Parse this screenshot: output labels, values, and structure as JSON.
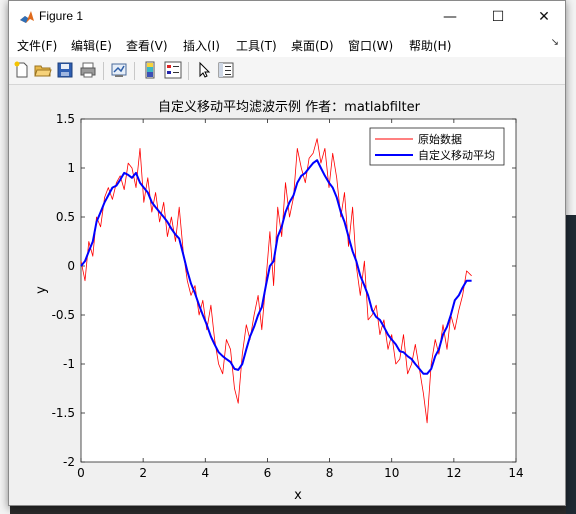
{
  "window": {
    "title": "Figure 1",
    "minimize_glyph": "—",
    "maximize_glyph": "☐",
    "close_glyph": "✕"
  },
  "menu": [
    {
      "label": "文件(F)"
    },
    {
      "label": "编辑(E)"
    },
    {
      "label": "查看(V)"
    },
    {
      "label": "插入(I)"
    },
    {
      "label": "工具(T)"
    },
    {
      "label": "桌面(D)"
    },
    {
      "label": "窗口(W)"
    },
    {
      "label": "帮助(H)"
    }
  ],
  "menu_overflow_glyph": "↘",
  "toolbar": {
    "icons": [
      "new-figure-icon",
      "open-folder-icon",
      "save-icon",
      "print-icon",
      "link-plot-icon",
      "insert-colorbar-icon",
      "insert-legend-icon",
      "pointer-icon",
      "property-editor-icon"
    ]
  },
  "colors": {
    "original": "#ff0000",
    "filtered": "#0000ff",
    "axes_bg": "#ffffff",
    "figure_bg": "#f0f0f0"
  },
  "chart_data": {
    "type": "line",
    "title": "自定义移动平均滤波示例 作者：matlabfilter",
    "xlabel": "x",
    "ylabel": "y",
    "xlim": [
      0,
      14
    ],
    "ylim": [
      -2,
      1.5
    ],
    "xticks": [
      "0",
      "2",
      "4",
      "6",
      "8",
      "10",
      "12",
      "14"
    ],
    "yticks": [
      "1.5",
      "1",
      "0.5",
      "0",
      "-0.5",
      "-1",
      "-1.5",
      "-2"
    ],
    "grid": false,
    "legend_position": "top-right",
    "series": [
      {
        "name": "原始数据",
        "color": "#ff0000",
        "linewidth": 0.8,
        "x": [
          0.0,
          0.13,
          0.25,
          0.38,
          0.5,
          0.63,
          0.76,
          0.88,
          1.01,
          1.14,
          1.26,
          1.39,
          1.52,
          1.64,
          1.77,
          1.9,
          2.02,
          2.15,
          2.28,
          2.4,
          2.53,
          2.66,
          2.78,
          2.91,
          3.04,
          3.16,
          3.29,
          3.42,
          3.54,
          3.67,
          3.8,
          3.92,
          4.05,
          4.18,
          4.3,
          4.43,
          4.56,
          4.68,
          4.81,
          4.94,
          5.06,
          5.19,
          5.32,
          5.44,
          5.57,
          5.7,
          5.82,
          5.95,
          6.08,
          6.2,
          6.33,
          6.46,
          6.58,
          6.71,
          6.84,
          6.96,
          7.09,
          7.22,
          7.34,
          7.47,
          7.6,
          7.72,
          7.85,
          7.98,
          8.1,
          8.23,
          8.36,
          8.48,
          8.61,
          8.74,
          8.86,
          8.99,
          9.12,
          9.24,
          9.37,
          9.5,
          9.62,
          9.75,
          9.88,
          10.0,
          10.13,
          10.26,
          10.38,
          10.51,
          10.64,
          10.76,
          10.89,
          11.02,
          11.14,
          11.27,
          11.4,
          11.52,
          11.65,
          11.78,
          11.9,
          12.03,
          12.16,
          12.28,
          12.41,
          12.57
        ],
        "y": [
          0.05,
          -0.15,
          0.25,
          0.1,
          0.5,
          0.4,
          0.7,
          0.8,
          0.68,
          0.85,
          0.92,
          0.78,
          1.05,
          1.0,
          0.8,
          1.2,
          0.65,
          0.9,
          0.55,
          0.75,
          0.45,
          0.65,
          0.3,
          0.5,
          0.25,
          0.6,
          0.15,
          -0.15,
          -0.3,
          -0.2,
          -0.5,
          -0.35,
          -0.65,
          -0.4,
          -0.75,
          -1.0,
          -1.1,
          -0.75,
          -0.85,
          -1.25,
          -1.4,
          -0.9,
          -0.6,
          -0.75,
          -0.5,
          -0.3,
          -0.65,
          -0.15,
          0.35,
          -0.2,
          0.6,
          0.3,
          0.85,
          0.5,
          0.7,
          1.2,
          1.0,
          0.85,
          1.1,
          1.15,
          1.3,
          1.05,
          1.2,
          0.8,
          1.15,
          0.9,
          0.5,
          0.75,
          0.2,
          0.6,
          0.0,
          -0.3,
          0.05,
          -0.55,
          -0.5,
          -0.4,
          -0.7,
          -0.55,
          -0.85,
          -0.7,
          -1.0,
          -0.95,
          -0.7,
          -1.1,
          -1.0,
          -0.8,
          -1.05,
          -1.3,
          -1.6,
          -1.0,
          -0.75,
          -0.9,
          -0.6,
          -0.85,
          -0.5,
          -0.65,
          -0.45,
          -0.3,
          -0.05,
          -0.1
        ]
      },
      {
        "name": "自定义移动平均",
        "color": "#0000ff",
        "linewidth": 2,
        "x": [
          0.0,
          0.13,
          0.25,
          0.38,
          0.5,
          0.63,
          0.76,
          0.88,
          1.01,
          1.14,
          1.26,
          1.39,
          1.52,
          1.64,
          1.77,
          1.9,
          2.02,
          2.15,
          2.28,
          2.4,
          2.53,
          2.66,
          2.78,
          2.91,
          3.04,
          3.16,
          3.29,
          3.42,
          3.54,
          3.67,
          3.8,
          3.92,
          4.05,
          4.18,
          4.3,
          4.43,
          4.56,
          4.68,
          4.81,
          4.94,
          5.06,
          5.19,
          5.32,
          5.44,
          5.57,
          5.7,
          5.82,
          5.95,
          6.08,
          6.2,
          6.33,
          6.46,
          6.58,
          6.71,
          6.84,
          6.96,
          7.09,
          7.22,
          7.34,
          7.47,
          7.6,
          7.72,
          7.85,
          7.98,
          8.1,
          8.23,
          8.36,
          8.48,
          8.61,
          8.74,
          8.86,
          8.99,
          9.12,
          9.24,
          9.37,
          9.5,
          9.62,
          9.75,
          9.88,
          10.0,
          10.13,
          10.26,
          10.38,
          10.51,
          10.64,
          10.76,
          10.89,
          11.02,
          11.14,
          11.27,
          11.4,
          11.52,
          11.65,
          11.78,
          11.9,
          12.03,
          12.16,
          12.28,
          12.41,
          12.57
        ],
        "y": [
          0.0,
          0.05,
          0.15,
          0.25,
          0.45,
          0.55,
          0.65,
          0.72,
          0.8,
          0.82,
          0.88,
          0.95,
          0.93,
          0.9,
          0.95,
          0.85,
          0.8,
          0.75,
          0.65,
          0.6,
          0.55,
          0.5,
          0.45,
          0.38,
          0.32,
          0.28,
          0.12,
          -0.05,
          -0.18,
          -0.28,
          -0.4,
          -0.5,
          -0.6,
          -0.72,
          -0.8,
          -0.88,
          -0.92,
          -0.95,
          -0.98,
          -1.05,
          -1.06,
          -1.0,
          -0.85,
          -0.72,
          -0.62,
          -0.5,
          -0.42,
          -0.2,
          0.0,
          0.05,
          0.3,
          0.4,
          0.55,
          0.65,
          0.72,
          0.85,
          0.92,
          0.95,
          1.0,
          1.05,
          1.08,
          1.0,
          0.92,
          0.85,
          0.8,
          0.7,
          0.55,
          0.45,
          0.3,
          0.15,
          0.05,
          -0.1,
          -0.2,
          -0.3,
          -0.45,
          -0.52,
          -0.55,
          -0.62,
          -0.7,
          -0.75,
          -0.8,
          -0.87,
          -0.88,
          -0.92,
          -0.95,
          -1.0,
          -1.05,
          -1.1,
          -1.1,
          -1.05,
          -0.92,
          -0.85,
          -0.7,
          -0.62,
          -0.5,
          -0.35,
          -0.3,
          -0.22,
          -0.15,
          -0.15
        ]
      }
    ]
  }
}
